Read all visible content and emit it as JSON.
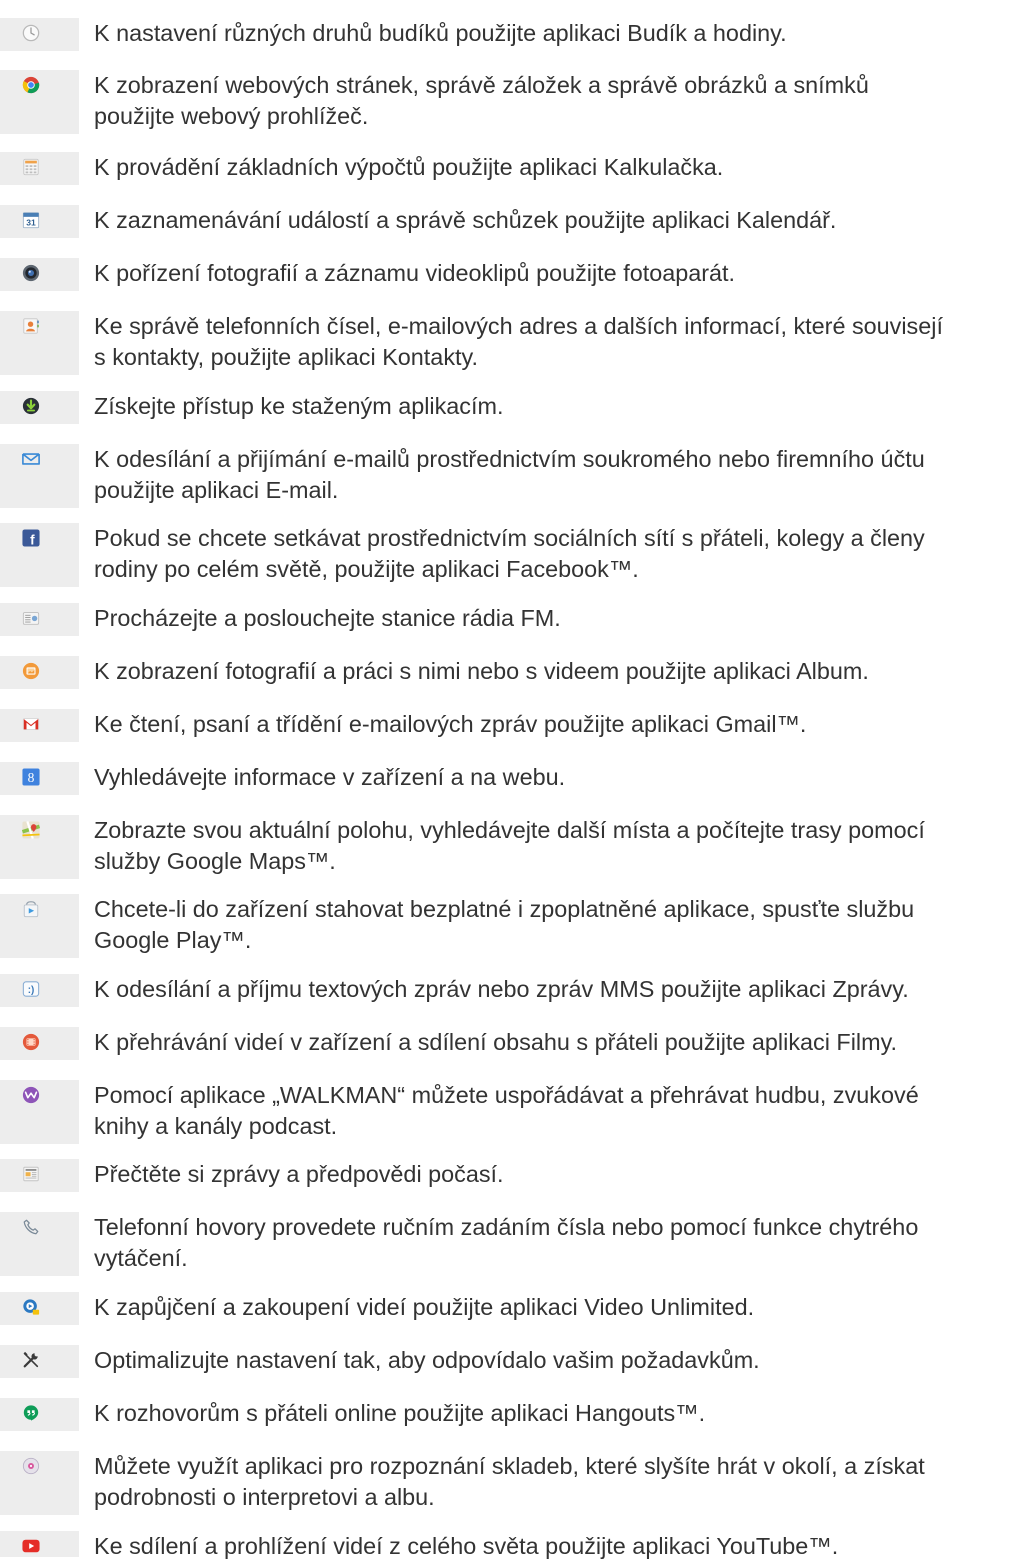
{
  "items": [
    {
      "icon": "clock-icon",
      "lines": [
        "K nastavení různých druhů budíků použijte aplikaci Budík a hodiny."
      ]
    },
    {
      "icon": "browser-icon",
      "lines": [
        "K zobrazení webových stránek, správě záložek a správě obrázků a snímků",
        "použijte webový prohlížeč."
      ]
    },
    {
      "icon": "calculator-icon",
      "lines": [
        "K provádění základních výpočtů použijte aplikaci Kalkulačka."
      ]
    },
    {
      "icon": "calendar-icon",
      "lines": [
        "K zaznamenávání událostí a správě schůzek použijte aplikaci Kalendář."
      ]
    },
    {
      "icon": "camera-icon",
      "lines": [
        "K pořízení fotografií a záznamu videoklipů použijte fotoaparát."
      ]
    },
    {
      "icon": "contacts-icon",
      "lines": [
        "Ke správě telefonních čísel, e-mailových adres a dalších informací, které souvisejí",
        "s kontakty, použijte aplikaci Kontakty."
      ]
    },
    {
      "icon": "download-icon",
      "lines": [
        "Získejte přístup ke staženým aplikacím."
      ]
    },
    {
      "icon": "email-icon",
      "lines": [
        "K odesílání a přijímání e-mailů prostřednictvím soukromého nebo firemního účtu",
        "použijte aplikaci E-mail."
      ]
    },
    {
      "icon": "facebook-icon",
      "lines": [
        "Pokud se chcete setkávat prostřednictvím sociálních sítí s přáteli, kolegy a členy",
        "rodiny po celém světě, použijte aplikaci Facebook™."
      ]
    },
    {
      "icon": "radio-icon",
      "lines": [
        "Procházejte a poslouchejte stanice rádia FM."
      ]
    },
    {
      "icon": "album-icon",
      "lines": [
        "K zobrazení fotografií a práci s nimi nebo s videem použijte aplikaci Album."
      ]
    },
    {
      "icon": "gmail-icon",
      "lines": [
        "Ke čtení, psaní a třídění e-mailových zpráv použijte aplikaci Gmail™."
      ]
    },
    {
      "icon": "google-search-icon",
      "glyph": "8",
      "lines": [
        "Vyhledávejte informace v zařízení a na webu."
      ]
    },
    {
      "icon": "maps-icon",
      "lines": [
        "Zobrazte svou aktuální polohu, vyhledávejte další místa a počítejte trasy pomocí",
        "služby Google Maps™."
      ]
    },
    {
      "icon": "play-store-icon",
      "lines": [
        "Chcete-li do zařízení stahovat bezplatné i zpoplatněné aplikace, spusťte službu",
        "Google Play™."
      ]
    },
    {
      "icon": "messages-icon",
      "glyph": ":)",
      "lines": [
        "K odesílání a příjmu textových zpráv nebo zpráv MMS použijte aplikaci Zprávy."
      ]
    },
    {
      "icon": "movies-icon",
      "lines": [
        "K přehrávání videí v zařízení a sdílení obsahu s přáteli použijte aplikaci Filmy."
      ]
    },
    {
      "icon": "walkman-icon",
      "lines": [
        "Pomocí aplikace „WALKMAN“ můžete uspořádávat a přehrávat hudbu, zvukové",
        "knihy a kanály podcast."
      ]
    },
    {
      "icon": "news-icon",
      "lines": [
        "Přečtěte si zprávy a předpovědi počasí."
      ]
    },
    {
      "icon": "phone-icon",
      "lines": [
        "Telefonní hovory provedete ručním zadáním čísla nebo pomocí funkce chytrého",
        "vytáčení."
      ]
    },
    {
      "icon": "video-unlimited-icon",
      "lines": [
        "K zapůjčení a zakoupení videí použijte aplikaci Video Unlimited."
      ]
    },
    {
      "icon": "settings-tools-icon",
      "lines": [
        "Optimalizujte nastavení tak, aby odpovídalo vašim požadavkům."
      ]
    },
    {
      "icon": "hangouts-icon",
      "lines": [
        "K rozhovorům s přáteli online použijte aplikaci Hangouts™."
      ]
    },
    {
      "icon": "trackid-icon",
      "lines": [
        "Můžete využít aplikaci pro rozpoznání skladeb, které slyšíte hrát v okolí, a získat",
        "podrobnosti o interpretovi a albu."
      ]
    },
    {
      "icon": "youtube-icon",
      "lines": [
        "Ke sdílení a prohlížení videí z celého světa použijte aplikaci YouTube™."
      ]
    }
  ]
}
